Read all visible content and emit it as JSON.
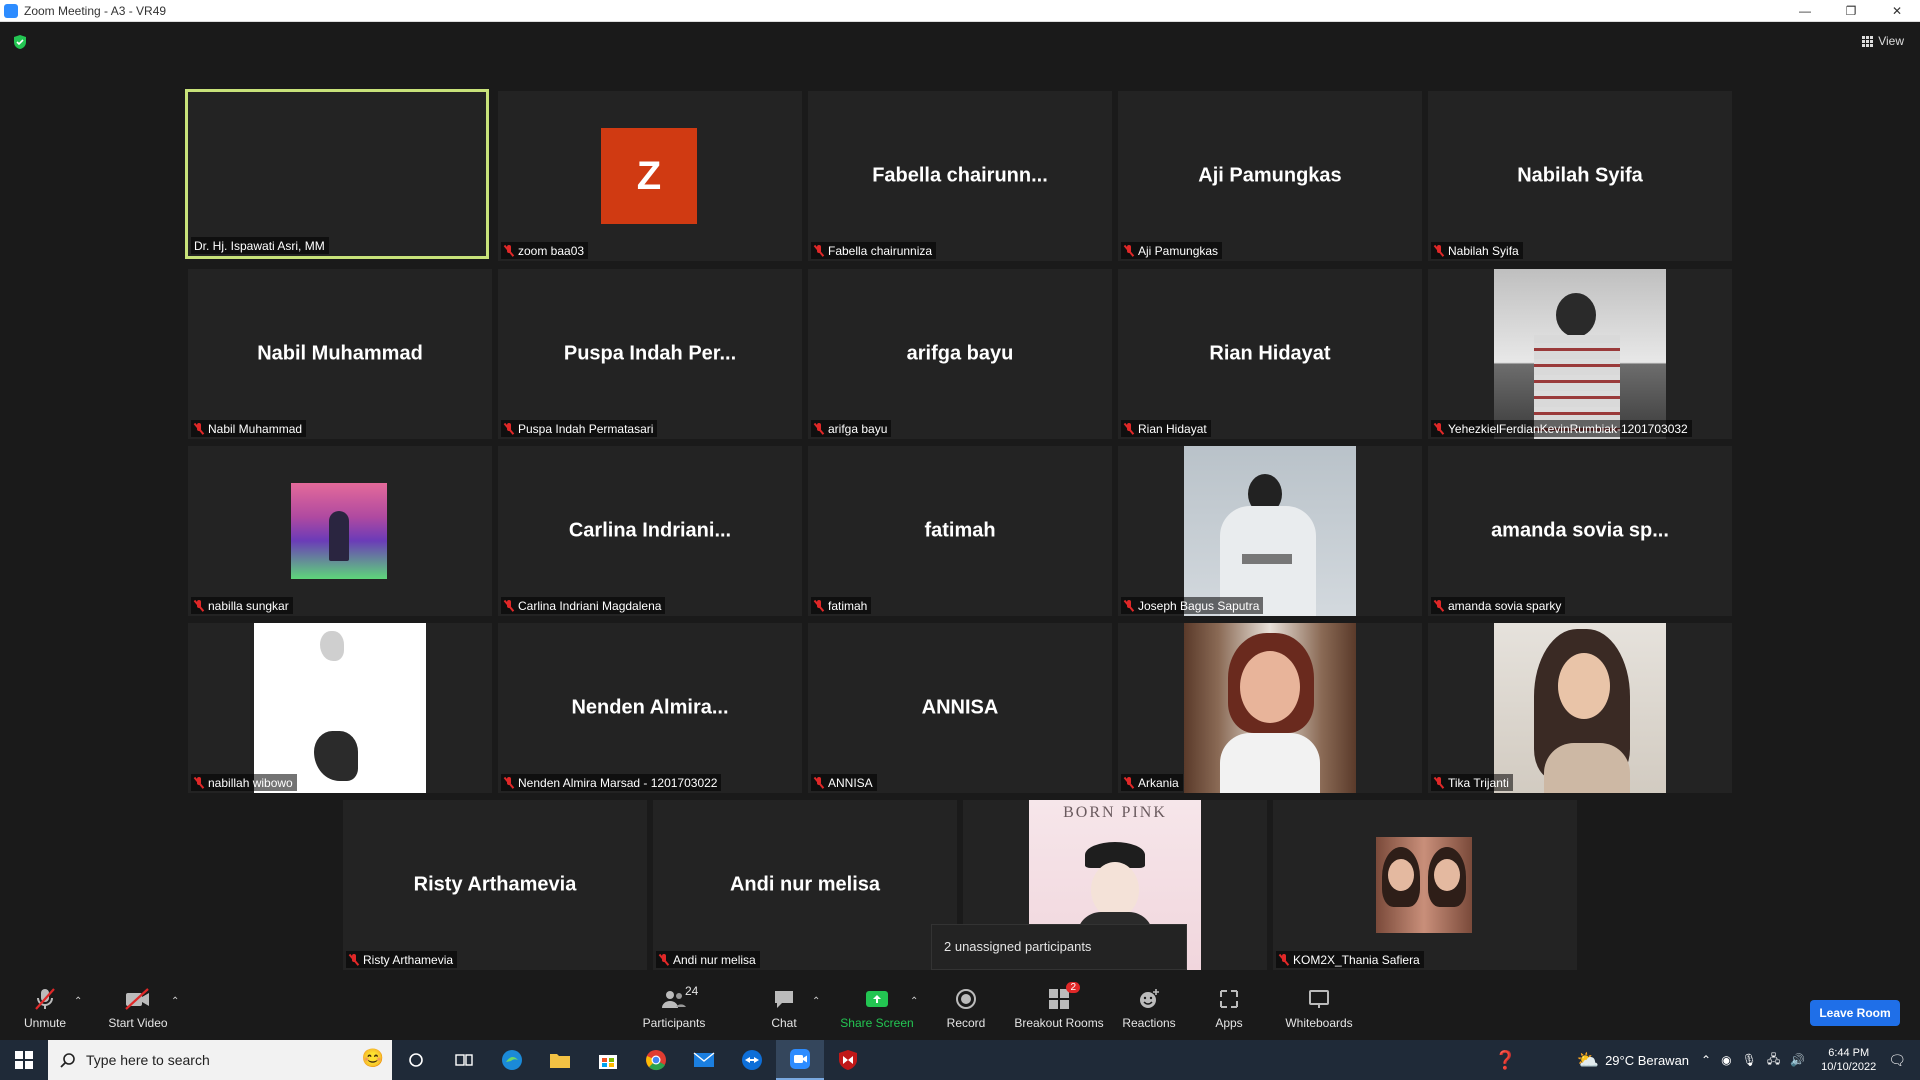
{
  "window": {
    "title": "Zoom Meeting - A3 - VR49",
    "controls": [
      "—",
      "❐",
      "✕"
    ]
  },
  "header": {
    "view_label": "View"
  },
  "tiles": [
    {
      "display": "",
      "label": "Dr. Hj. Ispawati Asri, MM",
      "muted": false,
      "active": true
    },
    {
      "display": "Z",
      "label": "zoom baa03",
      "muted": true
    },
    {
      "display": "Fabella  chairunn...",
      "label": "Fabella chairunniza",
      "muted": true
    },
    {
      "display": "Aji Pamungkas",
      "label": "Aji Pamungkas",
      "muted": true
    },
    {
      "display": "Nabilah Syifa",
      "label": "Nabilah Syifa",
      "muted": true
    },
    {
      "display": "Nabil Muhammad",
      "label": "Nabil Muhammad",
      "muted": true
    },
    {
      "display": "Puspa  Indah  Per...",
      "label": "Puspa Indah Permatasari",
      "muted": true
    },
    {
      "display": "arifga bayu",
      "label": "arifga bayu",
      "muted": true
    },
    {
      "display": "Rian Hidayat",
      "label": "Rian Hidayat",
      "muted": true
    },
    {
      "display": "",
      "label": "YehezkielFerdianKevinRumbiak-1201703032",
      "muted": true
    },
    {
      "display": "",
      "label": "nabilla sungkar",
      "muted": true
    },
    {
      "display": "Carlina  Indriani...",
      "label": "Carlina Indriani Magdalena",
      "muted": true
    },
    {
      "display": "fatimah",
      "label": "fatimah",
      "muted": true
    },
    {
      "display": "",
      "label": "Joseph Bagus Saputra",
      "muted": true
    },
    {
      "display": "amanda  sovia  sp...",
      "label": "amanda sovia sparky",
      "muted": true
    },
    {
      "display": "",
      "label": "nabillah wibowo",
      "muted": true
    },
    {
      "display": "Nenden  Almira...",
      "label": "Nenden Almira Marsad - 1201703022",
      "muted": true
    },
    {
      "display": "ANNISA",
      "label": "ANNISA",
      "muted": true
    },
    {
      "display": "",
      "label": "Arkania",
      "muted": true
    },
    {
      "display": "",
      "label": "Tika Trijanti",
      "muted": true
    },
    {
      "display": "Risty Arthamevia",
      "label": "Risty Arthamevia",
      "muted": true
    },
    {
      "display": "Andi nur melisa",
      "label": "Andi nur melisa",
      "muted": true
    },
    {
      "display": "BORN PINK",
      "label": "",
      "muted": false
    },
    {
      "display": "",
      "label": "KOM2X_Thania Safiera",
      "muted": true
    }
  ],
  "popup": {
    "text": "2 unassigned participants"
  },
  "toolbar": {
    "unmute": "Unmute",
    "start_video": "Start Video",
    "participants": "Participants",
    "participants_count": "24",
    "chat": "Chat",
    "share_screen": "Share Screen",
    "record": "Record",
    "breakout_rooms": "Breakout Rooms",
    "breakout_badge": "2",
    "reactions": "Reactions",
    "apps": "Apps",
    "whiteboards": "Whiteboards",
    "leave_room": "Leave Room"
  },
  "taskbar": {
    "search_placeholder": "Type here to search",
    "weather": "29°C  Berawan",
    "time": "6:44 PM",
    "date": "10/10/2022"
  },
  "colors": {
    "active_border": "#c8e27a",
    "mute_red": "#e02828",
    "leave_blue": "#1f6fe8",
    "share_green": "#23c552",
    "zoom_avatar": "#d03a12"
  }
}
